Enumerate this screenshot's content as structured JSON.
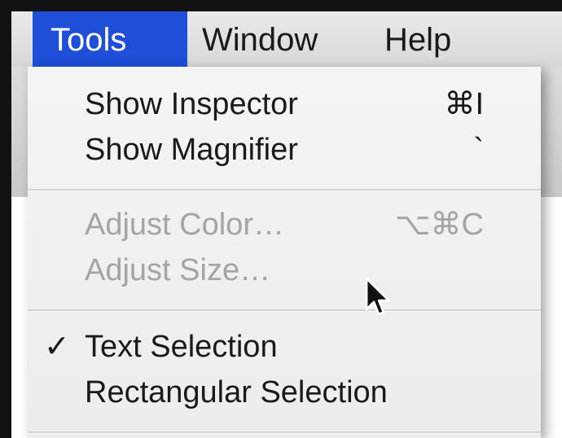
{
  "menubar": {
    "items": [
      {
        "label": "Tools",
        "active": true
      },
      {
        "label": "Window",
        "active": false
      },
      {
        "label": "Help",
        "active": false
      }
    ]
  },
  "tools_menu": {
    "sections": [
      {
        "items": [
          {
            "label": "Show Inspector",
            "shortcut": "⌘I",
            "enabled": true,
            "checked": false
          },
          {
            "label": "Show Magnifier",
            "shortcut": "`",
            "enabled": true,
            "checked": false
          }
        ]
      },
      {
        "items": [
          {
            "label": "Adjust Color…",
            "shortcut": "⌥⌘C",
            "enabled": false,
            "checked": false
          },
          {
            "label": "Adjust Size…",
            "shortcut": "",
            "enabled": false,
            "checked": false
          }
        ]
      },
      {
        "items": [
          {
            "label": "Text Selection",
            "shortcut": "",
            "enabled": true,
            "checked": true,
            "check_mark": "✓"
          },
          {
            "label": "Rectangular Selection",
            "shortcut": "",
            "enabled": true,
            "checked": false
          }
        ]
      }
    ]
  },
  "colors": {
    "menubar_active": "#1f4fd8",
    "menu_bg": "#f0f0f0",
    "disabled_text": "#a4a4a4"
  },
  "cursor": {
    "icon": "arrow-cursor-icon"
  }
}
